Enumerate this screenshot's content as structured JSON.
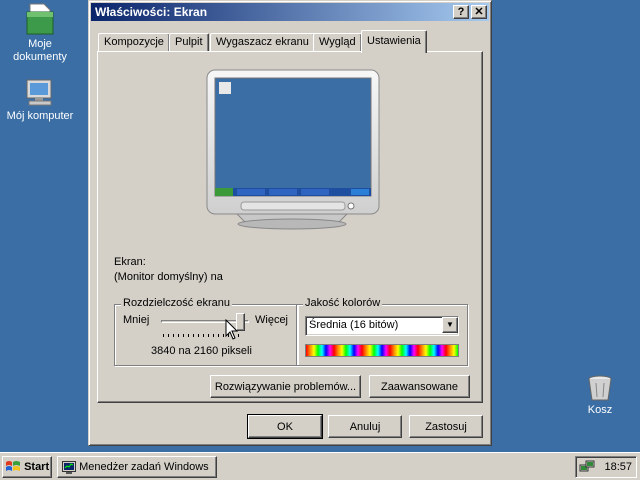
{
  "desktop": {
    "icons": [
      {
        "label": "Moje dokumenty",
        "icon": "my-documents-icon"
      },
      {
        "label": "Mój komputer",
        "icon": "my-computer-icon"
      },
      {
        "label": "Kosz",
        "icon": "recycle-bin-icon"
      }
    ],
    "background_color": "#3a6ea5"
  },
  "dialog": {
    "title": "Właściwości: Ekran",
    "help_button": "?",
    "close_button": "✕",
    "tabs": [
      {
        "label": "Kompozycje",
        "active": false
      },
      {
        "label": "Pulpit",
        "active": false
      },
      {
        "label": "Wygaszacz ekranu",
        "active": false
      },
      {
        "label": "Wygląd",
        "active": false
      },
      {
        "label": "Ustawienia",
        "active": true
      }
    ],
    "display_label": "Ekran:",
    "display_value": "(Monitor domyślny) na",
    "resolution": {
      "group_label": "Rozdzielczość ekranu",
      "less_label": "Mniej",
      "more_label": "Więcej",
      "value_text": "3840 na 2160 pikseli",
      "slider_level": 0.95
    },
    "colors": {
      "group_label": "Jakość kolorów",
      "selected": "Średnia (16 bitów)"
    },
    "troubleshoot_button": "Rozwiązywanie problemów...",
    "advanced_button": "Zaawansowane",
    "ok_button": "OK",
    "cancel_button": "Anuluj",
    "apply_button": "Zastosuj"
  },
  "taskbar": {
    "start_label": "Start",
    "tasks": [
      {
        "label": "Menedżer zadań Windows",
        "icon": "task-manager-icon"
      }
    ],
    "clock": "18:57",
    "tray_icons": [
      "network-icon"
    ]
  },
  "colors": {
    "title_active_start": "#0a246a",
    "title_active_end": "#a6caf0",
    "face": "#d4d0c8"
  }
}
